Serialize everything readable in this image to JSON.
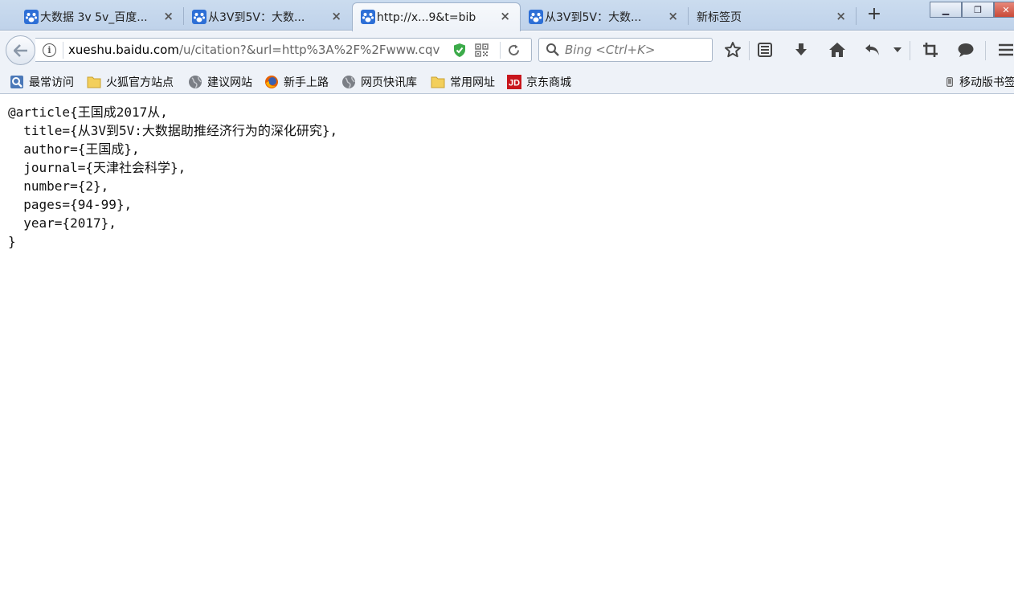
{
  "tabs": [
    {
      "title": "大数据 3v 5v_百度...",
      "favicon": "baidu-paw-icon",
      "close": "×",
      "active": false
    },
    {
      "title": "从3V到5V：大数...",
      "favicon": "baidu-paw-icon",
      "close": "×",
      "active": false
    },
    {
      "title": "http://x...9&t=bib",
      "favicon": "baidu-paw-icon",
      "close": "×",
      "active": true
    },
    {
      "title": "从3V到5V：大数...",
      "favicon": "baidu-paw-icon",
      "close": "×",
      "active": false
    },
    {
      "title": "新标签页",
      "favicon": "",
      "close": "×",
      "active": false
    }
  ],
  "new_tab_label": "+",
  "window_buttons": {
    "minimize": "▁",
    "restore": "❐",
    "close": "✕"
  },
  "url": {
    "host": "xueshu.baidu.com",
    "rest": "/u/citation?&url=http%3A%2F%2Fwww.cqv"
  },
  "search": {
    "placeholder": "Bing <Ctrl+K>"
  },
  "toolbar_icons": [
    "star-icon",
    "reading-list-icon",
    "download-icon",
    "home-icon",
    "undo-icon",
    "dropdown-icon",
    "crop-icon",
    "chat-icon",
    "menu-icon"
  ],
  "bookmarks": [
    {
      "label": "最常访问",
      "icon": "most-visited-icon"
    },
    {
      "label": "火狐官方站点",
      "icon": "folder-icon"
    },
    {
      "label": "建议网站",
      "icon": "globe-icon"
    },
    {
      "label": "新手上路",
      "icon": "firefox-icon"
    },
    {
      "label": "网页快讯库",
      "icon": "globe-icon"
    },
    {
      "label": "常用网址",
      "icon": "folder-icon"
    },
    {
      "label": "京东商城",
      "icon": "jd-icon",
      "badge": "JD"
    },
    {
      "label": "移动版书签",
      "icon": "mobile-icon"
    }
  ],
  "bibtex": {
    "lines": [
      "@article{王国成2017从,",
      "  title={从3V到5V:大数据助推经济行为的深化研究},",
      "  author={王国成},",
      "  journal={天津社会科学},",
      "  number={2},",
      "  pages={94-99},",
      "  year={2017},",
      "}"
    ]
  },
  "colors": {
    "tabstrip": "#c6d8ee",
    "navbar": "#eef2f8",
    "baidu_blue": "#2d6fd6",
    "jd_red": "#c8161d",
    "shield_green": "#3cab4a"
  }
}
